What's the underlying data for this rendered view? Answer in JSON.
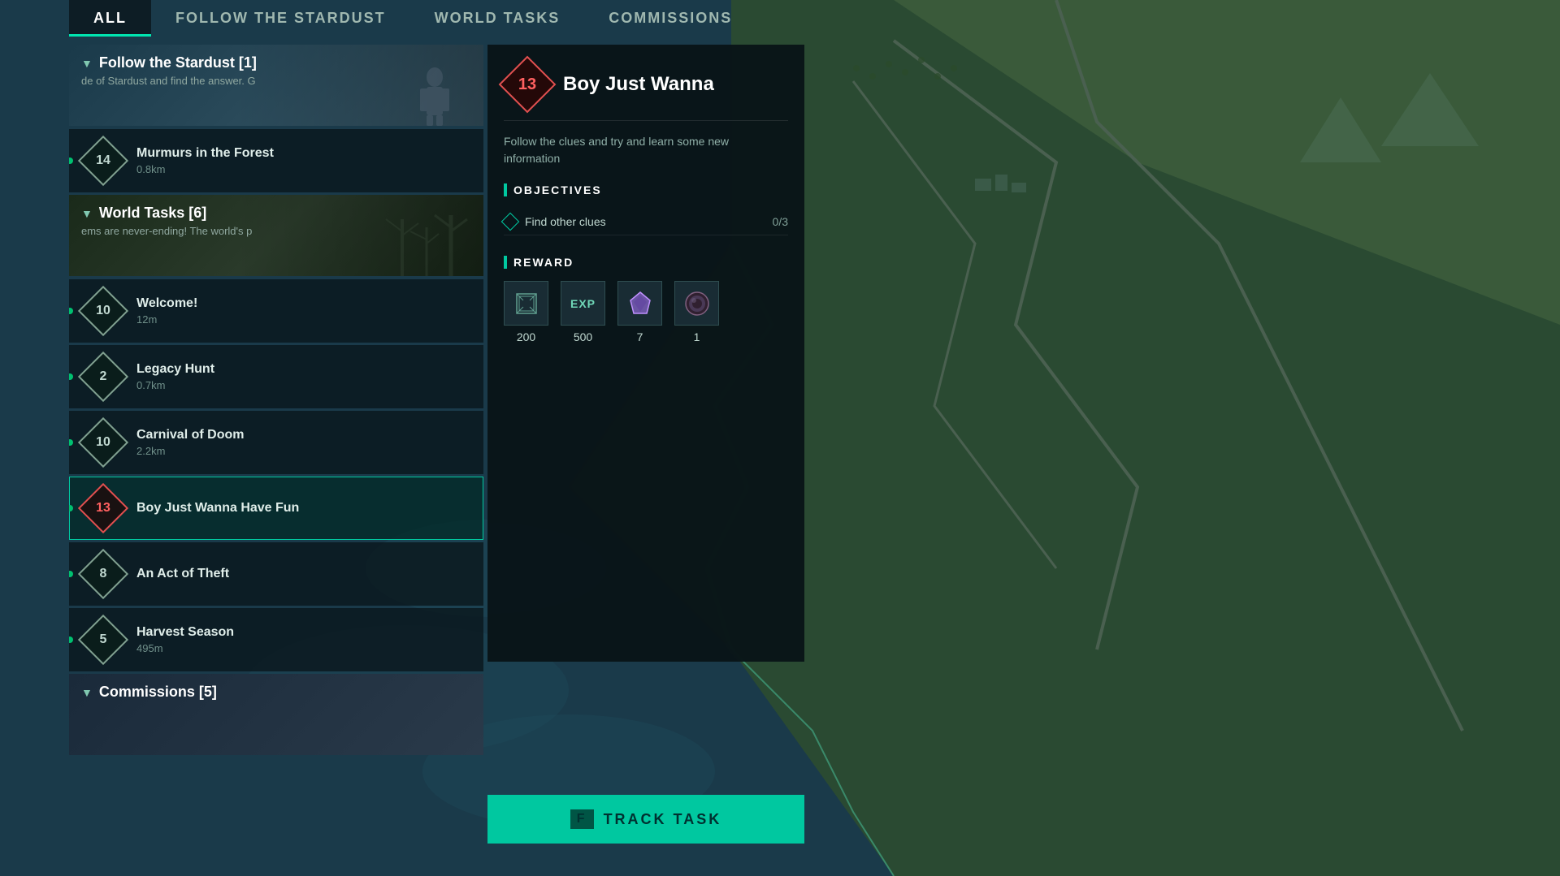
{
  "nav": {
    "tabs": [
      {
        "id": "all",
        "label": "ALL",
        "active": true
      },
      {
        "id": "follow-stardust",
        "label": "FOLLOW THE STARDUST",
        "active": false
      },
      {
        "id": "world-tasks",
        "label": "WORLD TASKS",
        "active": false
      },
      {
        "id": "commissions",
        "label": "COMMISSIONS",
        "active": false
      }
    ]
  },
  "sections": {
    "follow_stardust": {
      "title": "Follow the Stardust [1]",
      "subtitle": "de of Stardust and find the answer.   G",
      "chevron": "▼"
    },
    "world_tasks": {
      "title": "World Tasks [6]",
      "subtitle": "ems are never-ending!   The world's p",
      "chevron": "▼"
    },
    "commissions": {
      "title": "Commissions [5]",
      "chevron": "▼"
    }
  },
  "single_tasks": [
    {
      "id": "murmurs-forest",
      "number": "14",
      "name": "Murmurs in the Forest",
      "distance": "0.8km",
      "active": false,
      "dot": true
    }
  ],
  "world_task_items": [
    {
      "id": "welcome",
      "number": "10",
      "name": "Welcome!",
      "distance": "12m",
      "active": false,
      "dot": true
    },
    {
      "id": "legacy-hunt",
      "number": "2",
      "name": "Legacy Hunt",
      "distance": "0.7km",
      "active": false,
      "dot": true
    },
    {
      "id": "carnival-doom",
      "number": "10",
      "name": "Carnival of Doom",
      "distance": "2.2km",
      "active": false,
      "dot": true
    },
    {
      "id": "boy-wanna-fun",
      "number": "13",
      "name": "Boy Just Wanna Have Fun",
      "distance": "",
      "active": true,
      "dot": true
    },
    {
      "id": "act-of-theft",
      "number": "8",
      "name": "An Act of Theft",
      "distance": "",
      "active": false,
      "dot": true
    },
    {
      "id": "harvest-season",
      "number": "5",
      "name": "Harvest Season",
      "distance": "495m",
      "active": false,
      "dot": true
    }
  ],
  "detail": {
    "badge_number": "13",
    "title": "Boy Just Wanna",
    "description": "Follow the clues and try and learn some new information",
    "objectives_label": "OBJECTIVES",
    "objectives": [
      {
        "text": "Find other clues",
        "count": "0/3"
      }
    ],
    "reward_label": "REWARD",
    "rewards": [
      {
        "icon": "⊞",
        "value": "200",
        "type": "currency"
      },
      {
        "icon": "EXP",
        "value": "500",
        "type": "exp"
      },
      {
        "icon": "◈",
        "value": "7",
        "type": "gem"
      },
      {
        "icon": "●",
        "value": "1",
        "type": "item"
      }
    ],
    "track_button": "TRACK TASK",
    "track_key": "F"
  },
  "colors": {
    "accent": "#00c8a0",
    "active_border": "#00c8a0",
    "badge_active": "#e05050",
    "bg_dark": "#08141a",
    "text_primary": "#ffffff",
    "text_secondary": "#90b0a8"
  }
}
